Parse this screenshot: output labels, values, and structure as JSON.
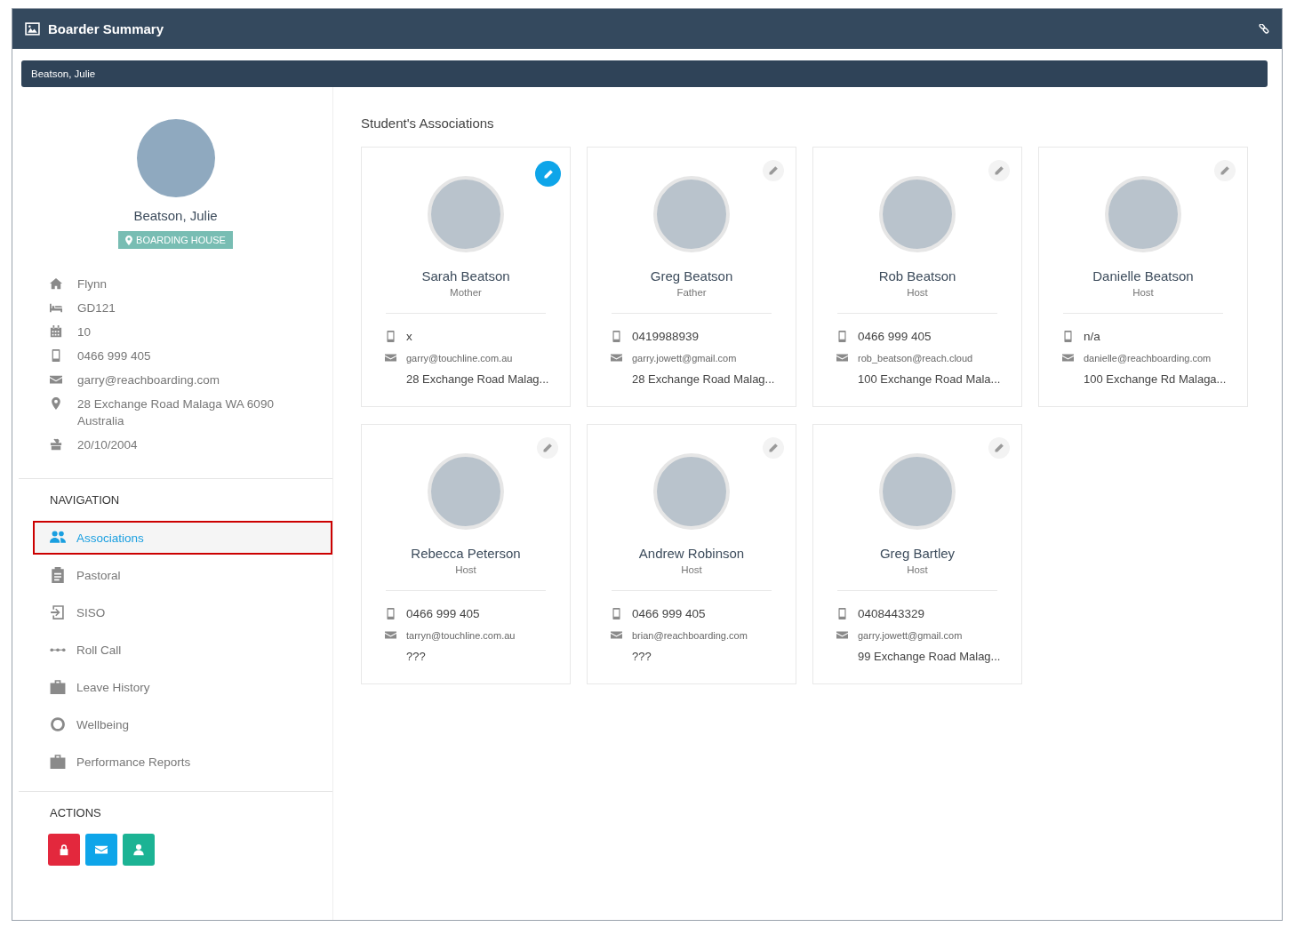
{
  "window": {
    "title": "Boarder Summary"
  },
  "student_selector": {
    "value": "Beatson, Julie"
  },
  "profile": {
    "name": "Beatson, Julie",
    "badge": "BOARDING HOUSE",
    "details": [
      {
        "kind": "house",
        "text": "Flynn"
      },
      {
        "kind": "room",
        "text": "GD121"
      },
      {
        "kind": "year",
        "text": "10"
      },
      {
        "kind": "phone",
        "text": "0466 999 405"
      },
      {
        "kind": "email",
        "text": "garry@reachboarding.com"
      },
      {
        "kind": "address",
        "text": "28 Exchange Road Malaga WA 6090 Australia"
      },
      {
        "kind": "birthday",
        "text": "20/10/2004"
      }
    ]
  },
  "navigation": {
    "heading": "NAVIGATION",
    "items": [
      {
        "kind": "people",
        "label": "Associations",
        "selected": true
      },
      {
        "kind": "clipboard",
        "label": "Pastoral",
        "selected": false
      },
      {
        "kind": "signin",
        "label": "SISO",
        "selected": false
      },
      {
        "kind": "dots",
        "label": "Roll Call",
        "selected": false
      },
      {
        "kind": "briefcase",
        "label": "Leave History",
        "selected": false
      },
      {
        "kind": "ring",
        "label": "Wellbeing",
        "selected": false
      },
      {
        "kind": "briefcase",
        "label": "Performance Reports",
        "selected": false
      }
    ]
  },
  "actions": {
    "heading": "ACTIONS",
    "buttons": [
      {
        "kind": "lock"
      },
      {
        "kind": "mail"
      },
      {
        "kind": "person"
      }
    ]
  },
  "associations": {
    "heading": "Student's Associations",
    "cards": [
      {
        "name": "Sarah Beatson",
        "relation": "Mother",
        "phone": "x",
        "email": "garry@touchline.com.au",
        "address": "28 Exchange Road Malag...",
        "edit_active": true
      },
      {
        "name": "Greg Beatson",
        "relation": "Father",
        "phone": "0419988939",
        "email": "garry.jowett@gmail.com",
        "address": "28 Exchange Road Malag...",
        "edit_active": false
      },
      {
        "name": "Rob Beatson",
        "relation": "Host",
        "phone": "0466 999 405",
        "email": "rob_beatson@reach.cloud",
        "address": "100 Exchange Road Mala...",
        "edit_active": false
      },
      {
        "name": "Danielle Beatson",
        "relation": "Host",
        "phone": "n/a",
        "email": "danielle@reachboarding.com",
        "address": "100 Exchange Rd Malaga...",
        "edit_active": false
      },
      {
        "name": "Rebecca Peterson",
        "relation": "Host",
        "phone": "0466 999 405",
        "email": "tarryn@touchline.com.au",
        "address": "???",
        "edit_active": false
      },
      {
        "name": "Andrew Robinson",
        "relation": "Host",
        "phone": "0466 999 405",
        "email": "brian@reachboarding.com",
        "address": "???",
        "edit_active": false
      },
      {
        "name": "Greg Bartley",
        "relation": "Host",
        "phone": "0408443329",
        "email": "garry.jowett@gmail.com",
        "address": "99 Exchange Road Malag...",
        "edit_active": false
      }
    ]
  }
}
